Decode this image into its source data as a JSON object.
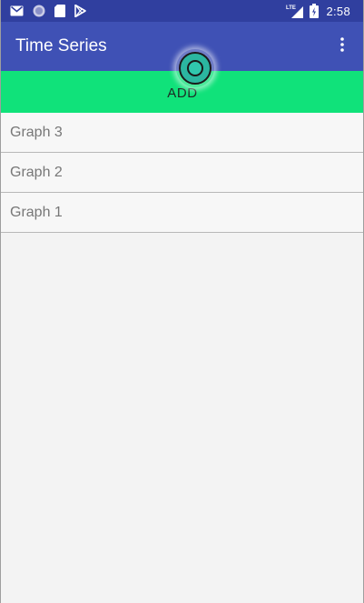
{
  "status_bar": {
    "left_icons": [
      "gmail-icon",
      "circle-notification-icon",
      "sd-card-icon",
      "play-store-icon"
    ],
    "network_label": "LTE",
    "clock": "2:58"
  },
  "app_bar": {
    "title": "Time Series"
  },
  "add_button": {
    "label": "ADD"
  },
  "graphs": [
    {
      "label": "Graph 3"
    },
    {
      "label": "Graph 2"
    },
    {
      "label": "Graph 1"
    }
  ],
  "colors": {
    "status_bar": "#303f9f",
    "app_bar": "#3f51b5",
    "add_button": "#10e27a",
    "background": "#f3f3f3"
  }
}
